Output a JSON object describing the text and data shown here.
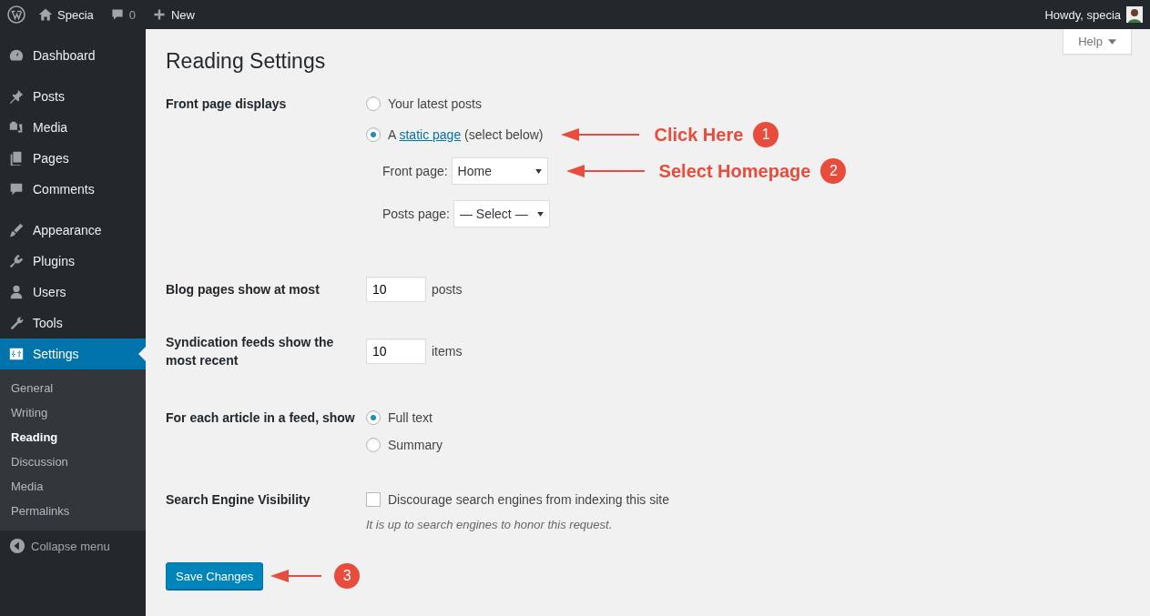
{
  "admin_bar": {
    "items": [
      {
        "kind": "logo"
      },
      {
        "kind": "home",
        "label": "Specia"
      },
      {
        "kind": "comments",
        "label": "0"
      },
      {
        "kind": "new",
        "label": "New"
      }
    ],
    "greeting": "Howdy, specia"
  },
  "sidebar": {
    "groups": [
      [
        {
          "kind": "dashboard",
          "label": "Dashboard",
          "selected": false
        }
      ],
      [
        {
          "kind": "posts",
          "label": "Posts",
          "selected": false
        },
        {
          "kind": "media",
          "label": "Media",
          "selected": false
        },
        {
          "kind": "pages",
          "label": "Pages",
          "selected": false
        },
        {
          "kind": "comments",
          "label": "Comments",
          "selected": false
        }
      ],
      [
        {
          "kind": "appearance",
          "label": "Appearance",
          "selected": false
        },
        {
          "kind": "plugins",
          "label": "Plugins",
          "selected": false
        },
        {
          "kind": "users",
          "label": "Users",
          "selected": false
        },
        {
          "kind": "tools",
          "label": "Tools",
          "selected": false
        },
        {
          "kind": "settings",
          "label": "Settings",
          "selected": true
        }
      ]
    ],
    "submenu": [
      {
        "label": "General",
        "selected": false
      },
      {
        "label": "Writing",
        "selected": false
      },
      {
        "label": "Reading",
        "selected": true
      },
      {
        "label": "Discussion",
        "selected": false
      },
      {
        "label": "Media",
        "selected": false
      },
      {
        "label": "Permalinks",
        "selected": false
      }
    ],
    "collapse": "Collapse menu"
  },
  "help_tab": "Help",
  "page_title": "Reading Settings",
  "front_page": {
    "label": "Front page displays",
    "options": [
      {
        "text": "Your latest posts",
        "selected": false
      },
      {
        "text": "A",
        "link": "static page",
        "suffix": "(select below)",
        "selected": true,
        "annotation": {
          "label": "Click Here",
          "number": "1"
        }
      }
    ],
    "selects": [
      {
        "label": "Front page:",
        "value": "Home",
        "annotation": {
          "label": "Select Homepage",
          "number": "2"
        }
      },
      {
        "label": "Posts page:",
        "value": "— Select —"
      }
    ]
  },
  "blog_pages": {
    "label": "Blog pages show at most",
    "value": "10",
    "unit": "posts"
  },
  "syndication": {
    "label": "Syndication feeds show the most recent",
    "value": "10",
    "unit": "items"
  },
  "feed_article": {
    "label": "For each article in a feed, show",
    "options": [
      {
        "text": "Full text",
        "selected": true
      },
      {
        "text": "Summary",
        "selected": false
      }
    ]
  },
  "search_visibility": {
    "label": "Search Engine Visibility",
    "checkbox": "Discourage search engines from indexing this site",
    "checked": false,
    "hint": "It is up to search engines to honor this request."
  },
  "save": {
    "label": "Save Changes",
    "annotation": {
      "number": "3"
    }
  }
}
